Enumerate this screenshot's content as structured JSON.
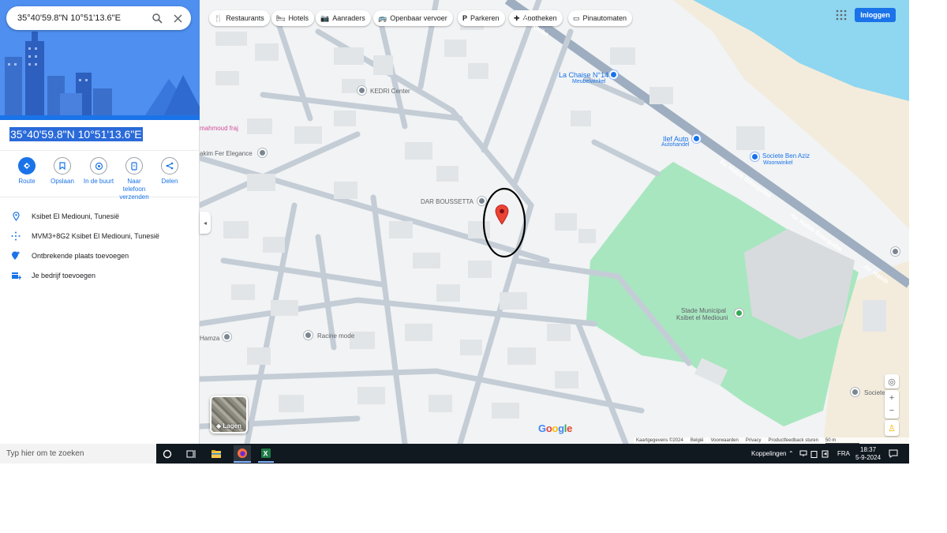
{
  "search": {
    "value": "35°40'59.8\"N 10°51'13.6\"E"
  },
  "place": {
    "title": "35°40'59.8\"N 10°51'13.6\"E",
    "actions": [
      {
        "label": "Route",
        "icon": "directions-icon"
      },
      {
        "label": "Opslaan",
        "icon": "bookmark-icon"
      },
      {
        "label": "In de buurt",
        "icon": "nearby-icon"
      },
      {
        "label": "Naar telefoon verzenden",
        "icon": "send-to-phone-icon"
      },
      {
        "label": "Delen",
        "icon": "share-icon"
      }
    ],
    "info": [
      {
        "text": "Ksibet El Mediouni, Tunesië",
        "icon": "location-pin-icon"
      },
      {
        "text": "MVM3+8G2 Ksibet El Mediouni, Tunesië",
        "icon": "plus-code-icon"
      },
      {
        "text": "Ontbrekende plaats toevoegen",
        "icon": "add-place-icon"
      },
      {
        "text": "Je bedrijf toevoegen",
        "icon": "add-business-icon"
      }
    ]
  },
  "map": {
    "chips": [
      {
        "label": "Restaurants",
        "glyph": "🍴"
      },
      {
        "label": "Hotels",
        "glyph": "🛏"
      },
      {
        "label": "Aanraders",
        "glyph": "📷"
      },
      {
        "label": "Openbaar vervoer",
        "glyph": "🚌"
      },
      {
        "label": "Parkeren",
        "glyph": "P"
      },
      {
        "label": "Apotheken",
        "glyph": "✚"
      },
      {
        "label": "Pinautomaten",
        "glyph": "▭"
      }
    ],
    "login_label": "Inloggen",
    "labels": {
      "kedri": "KEDRI Center",
      "lachaise": "La Chaise N°14",
      "meubel": "Meubelwinkel",
      "mahmoud": "mahmoud fraj",
      "elegance": "akim Fer Elegance",
      "autohandel_name": "Ilef Auto",
      "autohandel": "Autohandel",
      "benaziz": "Societe Ben Aziz",
      "woonwinkel": "Woonwinkel",
      "darboussetta": "DAR BOUSSETTA",
      "stade1": "Stade Municipal",
      "stade2": "Ksibet el Mediouni",
      "hamza": "Hamza",
      "racine": "Racine mode",
      "societe2": "Societe",
      "road1": "Av. Bourguiba",
      "road2": "Av. Habib Bourguiba",
      "road3": "Av. Habib Bourguiba",
      "road4": "Av. Habib"
    },
    "layers_label": "Lagen",
    "google_logo": "Google",
    "footer": [
      "Kaartgegevens ©2024",
      "België",
      "Voorwaarden",
      "Privacy",
      "Productfeedback sturen",
      "50 m"
    ]
  },
  "taskbar": {
    "search_placeholder": "Typ hier om te zoeken",
    "links_label": "Koppelingen",
    "lang": "FRA",
    "time": "18:37",
    "date": "5-9-2024"
  },
  "colors": {
    "accent": "#1a73e8",
    "park": "#a8e6c0",
    "water": "#8fd6f0",
    "pin": "#ea4335"
  }
}
